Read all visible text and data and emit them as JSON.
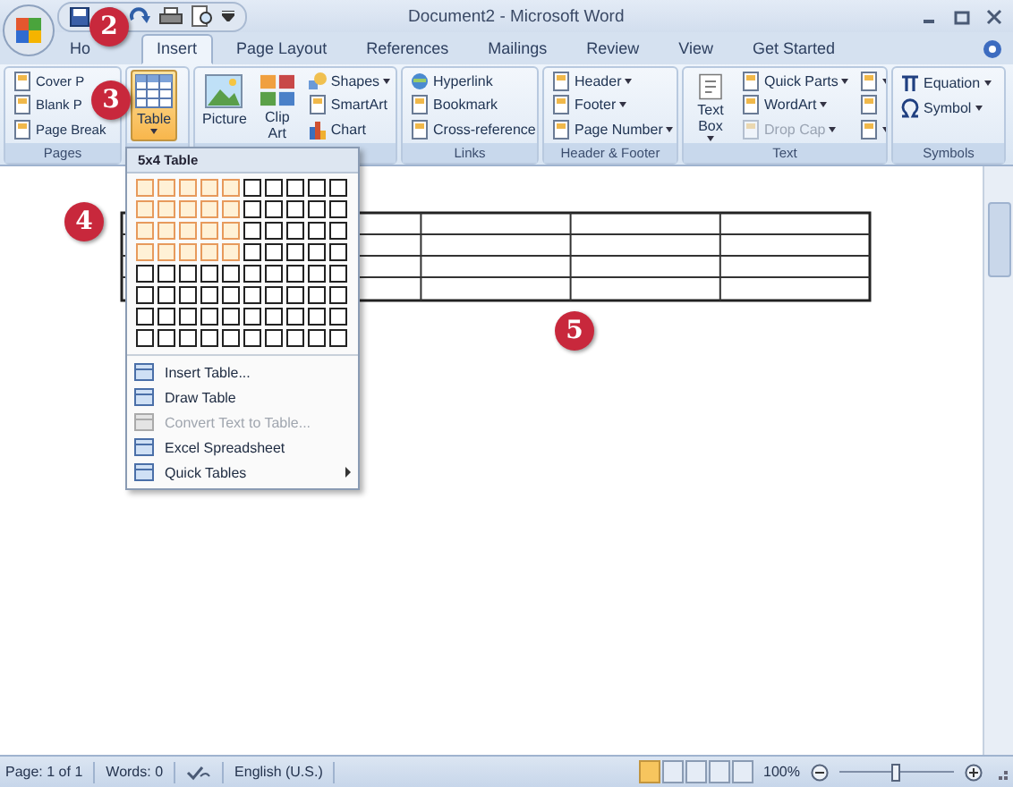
{
  "window": {
    "title": "Document2 - Microsoft Word"
  },
  "tabs": [
    {
      "label": "Ho",
      "selected": false
    },
    {
      "label": "Insert",
      "selected": true
    },
    {
      "label": "Page Layout",
      "selected": false
    },
    {
      "label": "References",
      "selected": false
    },
    {
      "label": "Mailings",
      "selected": false
    },
    {
      "label": "Review",
      "selected": false
    },
    {
      "label": "View",
      "selected": false
    },
    {
      "label": "Get Started",
      "selected": false
    }
  ],
  "ribbon": {
    "groups": [
      {
        "label": "Pages",
        "columns": [
          {
            "items": [
              {
                "kind": "small",
                "label": "Cover P",
                "dropdown": false,
                "pressed": false,
                "disabled": false
              },
              {
                "kind": "small",
                "label": "Blank P",
                "dropdown": false,
                "pressed": false,
                "disabled": false
              },
              {
                "kind": "small",
                "label": "Page Break",
                "dropdown": false,
                "pressed": false,
                "disabled": false
              }
            ]
          }
        ]
      },
      {
        "columns": [
          {
            "items": [
              {
                "kind": "large",
                "label": "Table",
                "dropdown": true,
                "pressed": true,
                "disabled": false
              }
            ]
          }
        ]
      },
      {
        "columns": [
          {
            "items": [
              {
                "kind": "large",
                "label": "Picture",
                "dropdown": false,
                "pressed": false,
                "disabled": false
              }
            ]
          },
          {
            "items": [
              {
                "kind": "large",
                "label": "Clip Art",
                "dropdown": false,
                "pressed": false,
                "disabled": false
              }
            ]
          },
          {
            "items": [
              {
                "kind": "small",
                "label": "Shapes",
                "dropdown": true,
                "pressed": false,
                "disabled": false
              },
              {
                "kind": "small",
                "label": "SmartArt",
                "dropdown": false,
                "pressed": false,
                "disabled": false
              },
              {
                "kind": "small",
                "label": "Chart",
                "dropdown": false,
                "pressed": false,
                "disabled": false
              }
            ]
          }
        ]
      },
      {
        "label": "Links",
        "columns": [
          {
            "items": [
              {
                "kind": "small",
                "label": "Hyperlink",
                "dropdown": false,
                "pressed": false,
                "disabled": false
              },
              {
                "kind": "small",
                "label": "Bookmark",
                "dropdown": false,
                "pressed": false,
                "disabled": false
              },
              {
                "kind": "small",
                "label": "Cross-reference",
                "dropdown": false,
                "pressed": false,
                "disabled": false
              }
            ]
          }
        ]
      },
      {
        "label": "Header & Footer",
        "columns": [
          {
            "items": [
              {
                "kind": "small",
                "label": "Header",
                "dropdown": true,
                "pressed": false,
                "disabled": false
              },
              {
                "kind": "small",
                "label": "Footer",
                "dropdown": true,
                "pressed": false,
                "disabled": false
              },
              {
                "kind": "small",
                "label": "Page Number",
                "dropdown": true,
                "pressed": false,
                "disabled": false
              }
            ]
          }
        ]
      },
      {
        "label": "Text",
        "columns": [
          {
            "items": [
              {
                "kind": "large",
                "label": "Text Box",
                "dropdown": true,
                "pressed": false,
                "disabled": false
              }
            ]
          },
          {
            "items": [
              {
                "kind": "small",
                "label": "Quick Parts",
                "dropdown": true,
                "pressed": false,
                "disabled": false
              },
              {
                "kind": "small",
                "label": "WordArt",
                "dropdown": true,
                "pressed": false,
                "disabled": false
              },
              {
                "kind": "small",
                "label": "Drop Cap",
                "dropdown": true,
                "pressed": false,
                "disabled": true
              }
            ]
          },
          {
            "items": [
              {
                "kind": "icon",
                "dropdown": true,
                "pressed": false,
                "disabled": false
              },
              {
                "kind": "icon",
                "dropdown": false,
                "pressed": false,
                "disabled": false
              },
              {
                "kind": "icon",
                "dropdown": true,
                "pressed": false,
                "disabled": false
              }
            ]
          }
        ]
      },
      {
        "label": "Symbols",
        "columns": [
          {
            "items": [
              {
                "kind": "small",
                "label": "Equation",
                "dropdown": true,
                "pressed": false,
                "disabled": false
              },
              {
                "kind": "small",
                "label": "Symbol",
                "dropdown": true,
                "pressed": false,
                "disabled": false
              }
            ]
          }
        ]
      }
    ]
  },
  "table_menu": {
    "header": "5x4 Table",
    "grid": [
      {
        "cells": [
          true,
          true,
          true,
          true,
          true,
          false,
          false,
          false,
          false,
          false
        ]
      },
      {
        "cells": [
          true,
          true,
          true,
          true,
          true,
          false,
          false,
          false,
          false,
          false
        ]
      },
      {
        "cells": [
          true,
          true,
          true,
          true,
          true,
          false,
          false,
          false,
          false,
          false
        ]
      },
      {
        "cells": [
          true,
          true,
          true,
          true,
          true,
          false,
          false,
          false,
          false,
          false
        ]
      },
      {
        "cells": [
          false,
          false,
          false,
          false,
          false,
          false,
          false,
          false,
          false,
          false
        ]
      },
      {
        "cells": [
          false,
          false,
          false,
          false,
          false,
          false,
          false,
          false,
          false,
          false
        ]
      },
      {
        "cells": [
          false,
          false,
          false,
          false,
          false,
          false,
          false,
          false,
          false,
          false
        ]
      },
      {
        "cells": [
          false,
          false,
          false,
          false,
          false,
          false,
          false,
          false,
          false,
          false
        ]
      }
    ],
    "items": [
      {
        "label": "Insert Table...",
        "disabled": false,
        "submenu": false
      },
      {
        "label": "Draw Table",
        "disabled": false,
        "submenu": false
      },
      {
        "label": "Convert Text to Table...",
        "disabled": true,
        "submenu": false
      },
      {
        "label": "Excel Spreadsheet",
        "disabled": false,
        "submenu": false
      },
      {
        "label": "Quick Tables",
        "disabled": false,
        "submenu": true
      }
    ]
  },
  "callouts": [
    {
      "label": "2"
    },
    {
      "label": "3"
    },
    {
      "label": "4"
    },
    {
      "label": "5"
    }
  ],
  "status_bar": {
    "page": "Page: 1 of 1",
    "words": "Words: 0",
    "language": "English (U.S.)",
    "views": [
      {
        "selected": true
      },
      {
        "selected": false
      },
      {
        "selected": false
      },
      {
        "selected": false
      },
      {
        "selected": false
      }
    ],
    "zoom": "100%",
    "zoom_level": {
      "level": 0.48
    }
  }
}
